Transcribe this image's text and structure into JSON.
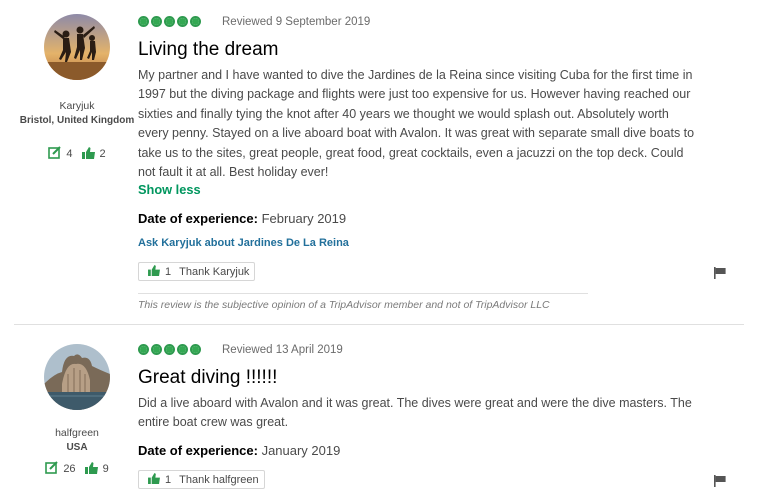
{
  "reviews": [
    {
      "user": {
        "name": "Karyjuk",
        "location": "Bristol, United Kingdom",
        "contributions": "4",
        "helpful_votes": "2"
      },
      "rating": 5,
      "reviewed_date": "Reviewed 9 September 2019",
      "title": "Living the dream",
      "text": "My partner and I have wanted to dive the Jardines de la Reina since visiting Cuba for the first time in 1997 but the diving package and flights were just too expensive for us. However having reached our sixties and finally tying the knot after 40 years we thought we would splash out. Absolutely worth every penny. Stayed on a live aboard boat with Avalon. It was great with separate small dive boats to take us to the sites, great people, great food, great cocktails, even a jacuzzi on the top deck. Could not fault it at all. Best holiday ever!",
      "show_less": "Show less",
      "date_label": "Date of experience:",
      "date_value": "February 2019",
      "ask_link": "Ask Karyjuk about Jardines De La Reina",
      "thank_count": "1",
      "thank_label": "Thank Karyjuk",
      "disclaimer": "This review is the subjective opinion of a TripAdvisor member and not of TripAdvisor LLC"
    },
    {
      "user": {
        "name": "halfgreen",
        "location": "USA",
        "contributions": "26",
        "helpful_votes": "9"
      },
      "rating": 5,
      "reviewed_date": "Reviewed 13 April 2019",
      "title": "Great diving !!!!!!",
      "text": "Did a live aboard with Avalon and it was great. The dives were great and were the dive masters. The entire boat crew was great.",
      "date_label": "Date of experience:",
      "date_value": "January 2019",
      "thank_count": "1",
      "thank_label": "Thank halfgreen"
    }
  ],
  "colors": {
    "bubble_green": "#34a853",
    "link_blue": "#22709b",
    "show_less_green": "#00965e"
  },
  "icons": [
    "pencil-contribution-icon",
    "thumbs-up-icon",
    "flag-icon",
    "rating-bubble-icon"
  ]
}
